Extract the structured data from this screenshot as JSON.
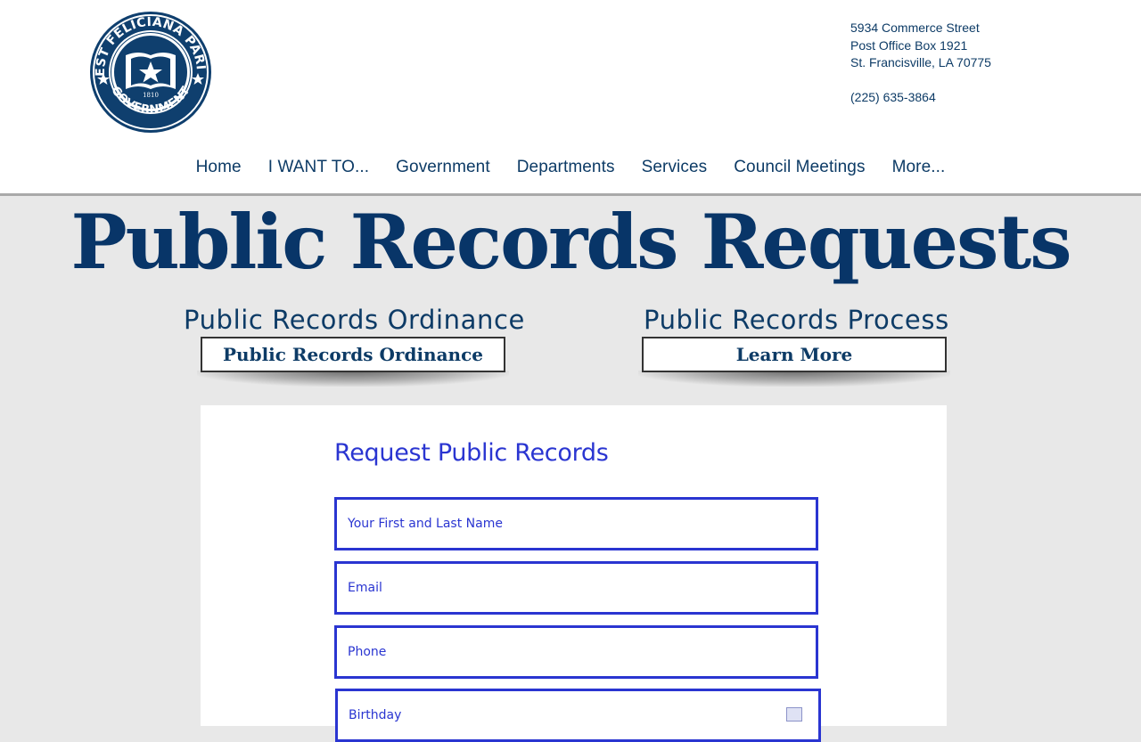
{
  "header": {
    "logo": {
      "top_text": "WEST FELICIANA PARISH",
      "bottom_text": "GOVERNMENT",
      "year": "1810"
    },
    "address": {
      "line1": "5934 Commerce Street",
      "line2": "Post Office Box 1921",
      "line3": "St. Francisville, LA 70775",
      "phone": "(225) 635-3864"
    },
    "nav": [
      {
        "label": "Home"
      },
      {
        "label": "I WANT TO..."
      },
      {
        "label": "Government"
      },
      {
        "label": "Departments"
      },
      {
        "label": "Services"
      },
      {
        "label": "Council Meetings"
      },
      {
        "label": "More..."
      }
    ]
  },
  "main": {
    "title": "Public Records Requests",
    "ordinance": {
      "heading": "Public Records Ordinance",
      "button_label": "Public Records Ordinance"
    },
    "process": {
      "heading": "Public Records Process",
      "button_label": "Learn More"
    }
  },
  "form": {
    "title": "Request Public Records",
    "name_placeholder": "Your First and Last Name",
    "email_placeholder": "Email",
    "phone_placeholder": "Phone",
    "birthday_placeholder": "Birthday"
  },
  "colors": {
    "navy": "#0d3b66",
    "title_navy": "#083568",
    "form_blue": "#2a35d1",
    "page_bg": "#e8e8e8"
  }
}
